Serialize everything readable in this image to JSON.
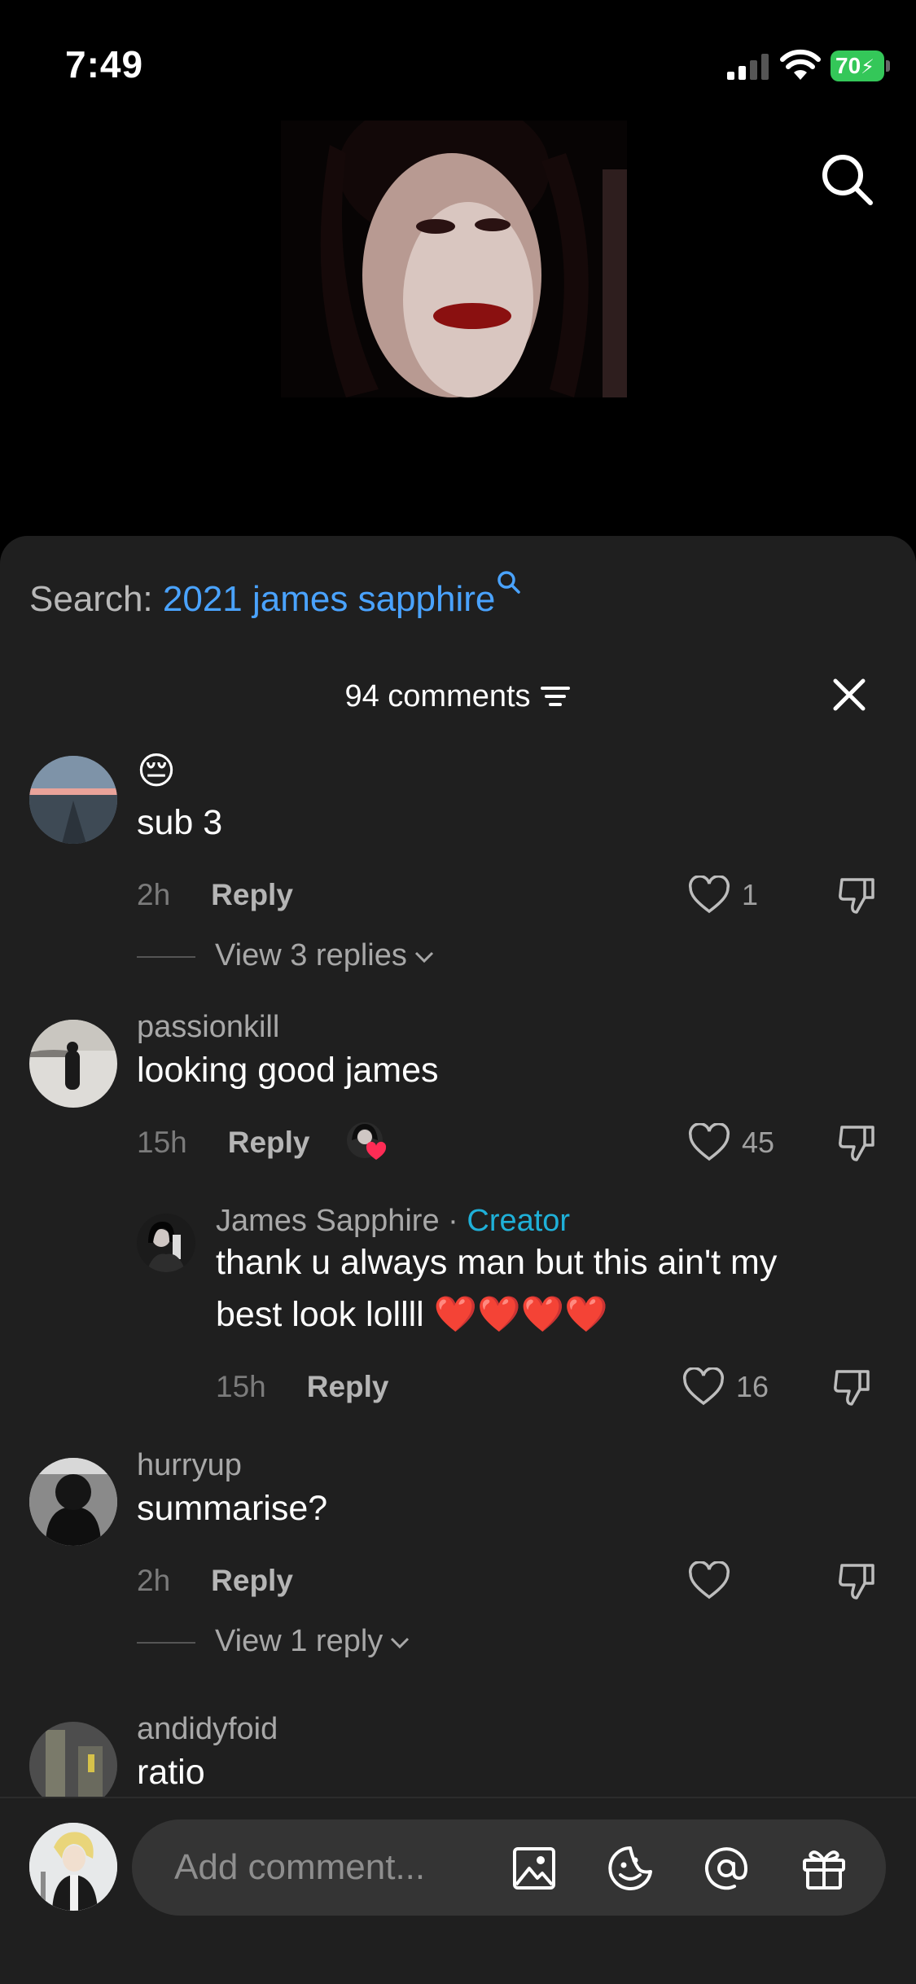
{
  "status_bar": {
    "time": "7:49",
    "battery": "70"
  },
  "sheet": {
    "search_prefix": "Search:",
    "search_query": "2021 james sapphire",
    "comments_count": "94 comments"
  },
  "comments": [
    {
      "username": "",
      "emoji": "😔",
      "text": "sub 3",
      "time": "2h",
      "reply_label": "Reply",
      "likes": "1",
      "view_replies": "View 3 replies"
    },
    {
      "username": "passionkill",
      "text": "looking good james",
      "time": "15h",
      "reply_label": "Reply",
      "likes": "45"
    },
    {
      "username": "James Sapphire",
      "separator": "·",
      "badge": "Creator",
      "text_line1": "thank u always man but this ain't my",
      "text_line2": "best look lollll ❤️❤️❤️❤️",
      "time": "15h",
      "reply_label": "Reply",
      "likes": "16"
    },
    {
      "username": "hurryup",
      "text": "summarise?",
      "time": "2h",
      "reply_label": "Reply",
      "likes": "",
      "view_replies": "View 1 reply"
    },
    {
      "username": "andidyfoid",
      "text": "ratio"
    }
  ],
  "input": {
    "placeholder": "Add comment..."
  },
  "icons": {
    "search": "search-icon",
    "filter": "filter-icon",
    "close": "close-icon",
    "heart": "heart-icon",
    "dislike": "dislike-icon",
    "image": "image-icon",
    "sticker": "sticker-icon",
    "mention": "at-icon",
    "gift": "gift-icon"
  },
  "colors": {
    "accent_link": "#4aa3ff",
    "creator_badge": "#1fb0d8",
    "battery": "#34c759",
    "sheet_bg": "#1f1f1f"
  }
}
